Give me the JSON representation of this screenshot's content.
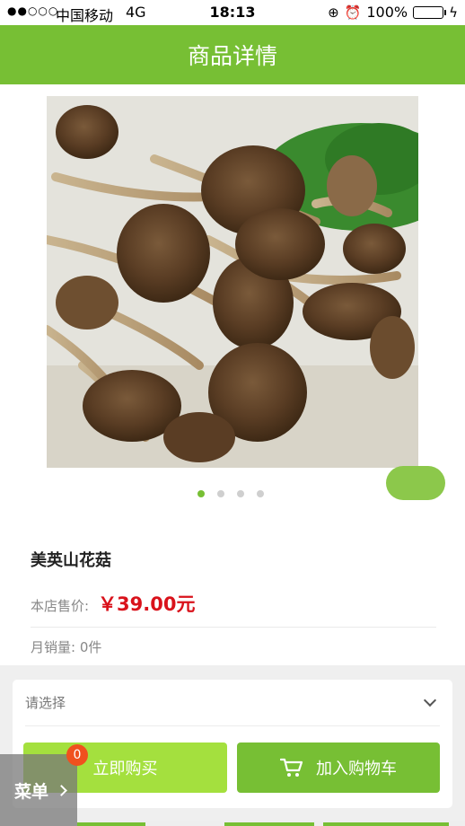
{
  "status_bar": {
    "signal": "●●○○○",
    "carrier": "中国移动",
    "network": "4G",
    "time": "18:13",
    "battery": "100%"
  },
  "header": {
    "title": "商品详情"
  },
  "gallery": {
    "image_icon": "product-photo",
    "slides": 4,
    "active_slide": 1
  },
  "product": {
    "name": "美英山花菇",
    "price_label": "本店售价:",
    "price": "￥39.00元",
    "sales": "月销量: 0件"
  },
  "options": {
    "select_label": "请选择"
  },
  "actions": {
    "buy_now": "立即购买",
    "add_to_cart": "加入购物车"
  },
  "float_menu": {
    "label": "菜单",
    "badge": "0"
  },
  "colors": {
    "accent": "#77bf34",
    "buy_button": "#a4e03e",
    "price": "#d9121b",
    "badge": "#f0511e"
  }
}
